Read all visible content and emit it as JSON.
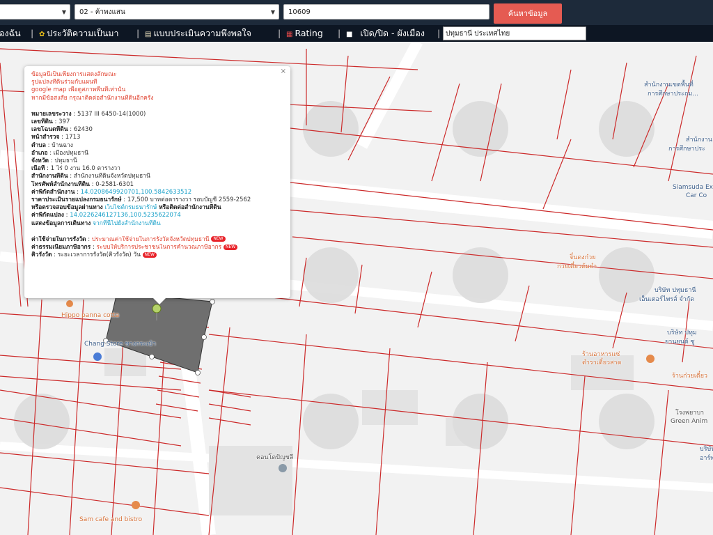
{
  "header": {
    "province_select": "",
    "district_select": "02 - ค้าพงแสน",
    "deed_input": "10609",
    "search_button": "ค้นหาข้อมูล"
  },
  "nav": {
    "items": [
      "องฉัน",
      "ประวัติความเป็นมา",
      "แบบประเมินความพึงพอใจ",
      "Rating",
      "เปิด/ปิด - ผังเมือง"
    ],
    "location_input": "ปทุมธานี ประเทศไทย"
  },
  "map": {
    "pois": [
      {
        "label": "สำนักงานเขตพื้นที่",
        "color": "blue"
      },
      {
        "label": "การศึกษาประถม...",
        "color": "blue"
      },
      {
        "label": "สำนักงาน",
        "color": "blue"
      },
      {
        "label": "การศึกษาประ",
        "color": "blue"
      },
      {
        "label": "Siamsuda Ex",
        "color": "blue"
      },
      {
        "label": "Car Co",
        "color": "blue"
      },
      {
        "label": "จิ๋นดงก๋วย",
        "color": "orange"
      },
      {
        "label": "ก๋วยเตี๋ยวต้มยำ",
        "color": "orange"
      },
      {
        "label": "บริษัท ปทุมธานี",
        "color": "blue"
      },
      {
        "label": "เอ็นเตอร์ไพรส์ จำกัด",
        "color": "blue"
      },
      {
        "label": "บริษัท ปทุม",
        "color": "blue"
      },
      {
        "label": "ยานยนต์ ซู",
        "color": "blue"
      },
      {
        "label": "ร้านอาหารแซ่",
        "color": "orange"
      },
      {
        "label": "ตำราเตี๋ยวสาด",
        "color": "orange"
      },
      {
        "label": "ร้านก๋วยเตี๋ยว",
        "color": "orange"
      },
      {
        "label": "โรงพยาบา",
        "color": "gray"
      },
      {
        "label": "Green Anim",
        "color": "gray"
      },
      {
        "label": "บริษัท",
        "color": "blue"
      },
      {
        "label": "อาร์ทแ",
        "color": "blue"
      },
      {
        "label": "Hippo panna cotta",
        "color": "orange"
      },
      {
        "label": "Chang Store ชางกระเป๋า",
        "color": "blue"
      },
      {
        "label": "คอนโดปัญชลี",
        "color": "gray"
      },
      {
        "label": "Sam cafe and bistro",
        "color": "orange"
      }
    ]
  },
  "popup": {
    "close_label": "×",
    "notice": [
      "ข้อมูลนี้เป็นเพียงการแสดงลักษณะ",
      "รูปแปลงที่ดินร่วมกับแผนที่",
      "google map เพื่อดูสภาพพื้นที่เท่านั้น",
      "หากมีข้อสงสัย กรุณาติดต่อสำนักงานที่ดินอีกครั้ง"
    ],
    "fields": [
      {
        "label": "หมายเลขระวาง",
        "value": "5137 III 6450-14(1000)"
      },
      {
        "label": "เลขที่ดิน",
        "value": "397"
      },
      {
        "label": "เลขโฉนดที่ดิน",
        "value": "62430"
      },
      {
        "label": "หน้าสำรวจ",
        "value": "1713"
      },
      {
        "label": "ตำบล",
        "value": "บ้านฉาง"
      },
      {
        "label": "อำเภอ",
        "value": "เมืองปทุมธานี"
      },
      {
        "label": "จังหวัด",
        "value": "ปทุมธานี"
      },
      {
        "label": "เนื้อที่",
        "value": "1 ไร่ 0 งาน 16.0 ตารางวา"
      },
      {
        "label": "สำนักงานที่ดิน",
        "value": "สำนักงานที่ดินจังหวัดปทุมธานี"
      },
      {
        "label": "โทรศัพท์สำนักงานที่ดิน",
        "value": "0-2581-6301"
      }
    ],
    "office_coord_label": "ค่าพิกัดสำนักงาน",
    "office_coord_value": "14.0208649920701,100.5842633512",
    "price_label": "ราคาประเมินรายแปลงกรมธนารักษ์",
    "price_value": "17,500 บาทต่อตารางวา รอบบัญชี 2559-2562",
    "check_prefix": "หรือตรวจสอบข้อมูลผ่านทาง",
    "check_link": "เว็บไซต์กรมธนารักษ์",
    "check_suffix": "หรือติดต่อสำนักงานที่ดิน",
    "parcel_coord_label": "ค่าพิกัดแปลง",
    "parcel_coord_value": "14.0226246127136,100.5235622074",
    "route_label": "แสดงข้อมูลการเดินทาง",
    "route_link": "จากที่นี่ไปยังสำนักงานที่ดิน",
    "extra": [
      {
        "label": "ค่าใช้จ่ายในการรังวัด",
        "link": "ประมาณค่าใช้จ่ายในการรังวัดจังหวัดปทุมธานี"
      },
      {
        "label": "ค่าธรรมเนียมภาษีอากร",
        "link": "ระบบให้บริการประชาชนในการคำนวณภาษีอากร"
      },
      {
        "label": "คิวรังวัด",
        "link": "ระยะเวลาการรังวัด(คิวรังวัด) วัน"
      }
    ],
    "new_badge": "NEW"
  },
  "colors": {
    "topbar": "#1d2a3a",
    "navbar": "#0d1623",
    "parcel_line": "#cc2a2a",
    "parcel_fill": "#6f6f6f",
    "search_button": "#e55b52",
    "link": "#1ba1c9",
    "notice": "#e0412e"
  }
}
